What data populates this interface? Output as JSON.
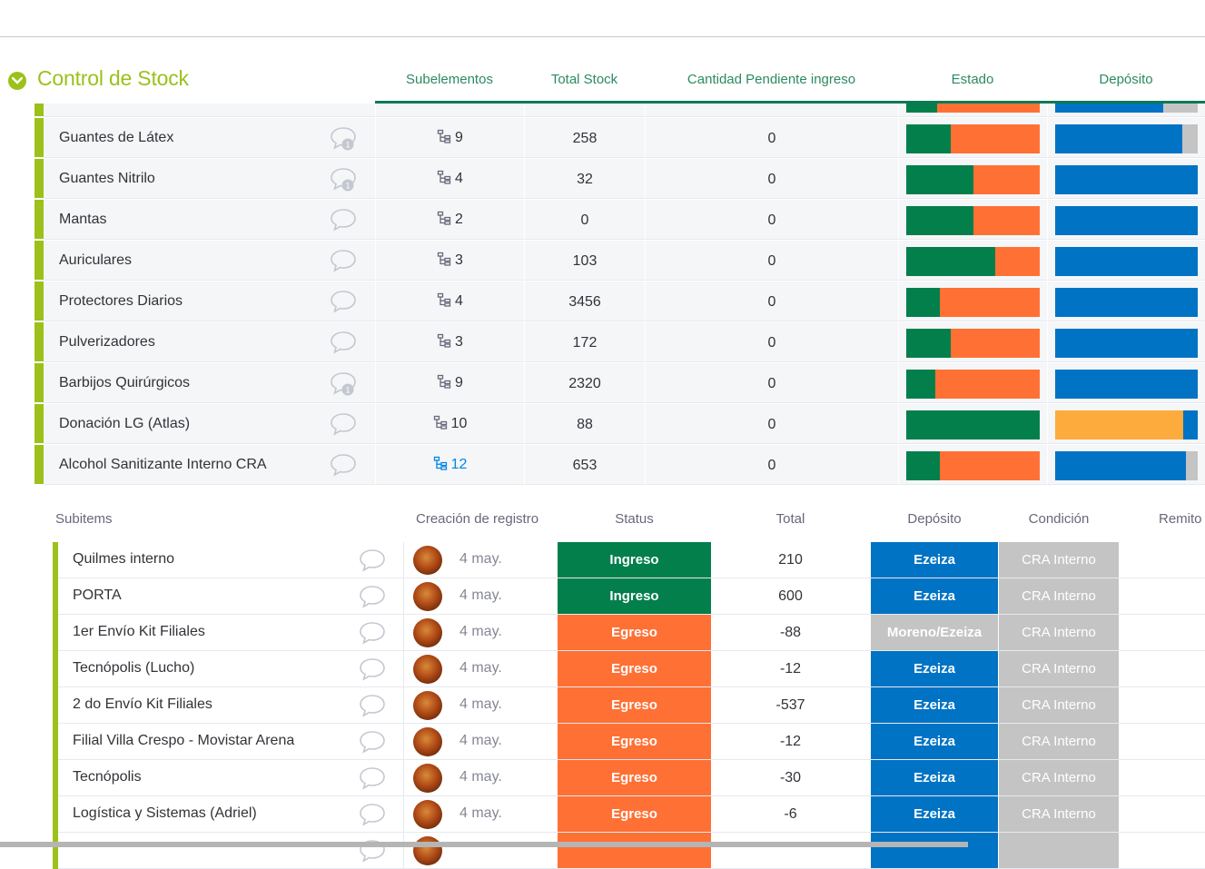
{
  "group": {
    "title": "Control de Stock",
    "color": "#9cc11a"
  },
  "columns": {
    "subelementos": "Subelementos",
    "total_stock": "Total Stock",
    "pendiente": "Cantidad Pendiente ingreso",
    "estado": "Estado",
    "deposito": "Depósito"
  },
  "items": [
    {
      "name": "",
      "sub": "",
      "stock": "",
      "pend": "",
      "estado": [
        0.23,
        0.77
      ],
      "deposito": [
        {
          "c": "#0073c4",
          "v": 0.76
        },
        {
          "c": "#c4c4c4",
          "v": 0.24
        }
      ],
      "partial": true
    },
    {
      "name": "Guantes de Látex",
      "sub": "9",
      "stock": "258",
      "pend": "0",
      "estado": [
        0.33,
        0.67
      ],
      "deposito": [
        {
          "c": "#0073c4",
          "v": 0.89
        },
        {
          "c": "#c4c4c4",
          "v": 0.11
        }
      ],
      "badge": "1"
    },
    {
      "name": "Guantes Nitrilo",
      "sub": "4",
      "stock": "32",
      "pend": "0",
      "estado": [
        0.5,
        0.5
      ],
      "deposito": [
        {
          "c": "#0073c4",
          "v": 1.0
        }
      ],
      "badge": "1"
    },
    {
      "name": "Mantas",
      "sub": "2",
      "stock": "0",
      "pend": "0",
      "estado": [
        0.5,
        0.5
      ],
      "deposito": [
        {
          "c": "#0073c4",
          "v": 1.0
        }
      ]
    },
    {
      "name": "Auriculares",
      "sub": "3",
      "stock": "103",
      "pend": "0",
      "estado": [
        0.67,
        0.33
      ],
      "deposito": [
        {
          "c": "#0073c4",
          "v": 1.0
        }
      ]
    },
    {
      "name": "Protectores Diarios",
      "sub": "4",
      "stock": "3456",
      "pend": "0",
      "estado": [
        0.25,
        0.75
      ],
      "deposito": [
        {
          "c": "#0073c4",
          "v": 1.0
        }
      ]
    },
    {
      "name": "Pulverizadores",
      "sub": "3",
      "stock": "172",
      "pend": "0",
      "estado": [
        0.33,
        0.67
      ],
      "deposito": [
        {
          "c": "#0073c4",
          "v": 1.0
        }
      ]
    },
    {
      "name": "Barbijos Quirúrgicos",
      "sub": "9",
      "stock": "2320",
      "pend": "0",
      "estado": [
        0.22,
        0.78
      ],
      "deposito": [
        {
          "c": "#0073c4",
          "v": 1.0
        }
      ],
      "badge": "1"
    },
    {
      "name": "Donación LG (Atlas)",
      "sub": "10",
      "stock": "88",
      "pend": "0",
      "estado": [
        1.0,
        0.0
      ],
      "deposito": [
        {
          "c": "#fdab3d",
          "v": 0.9
        },
        {
          "c": "#0073c4",
          "v": 0.1
        }
      ]
    },
    {
      "name": "Alcohol Sanitizante Interno CRA",
      "sub": "12",
      "stock": "653",
      "pend": "0",
      "estado": [
        0.25,
        0.75
      ],
      "deposito": [
        {
          "c": "#0073c4",
          "v": 0.92
        },
        {
          "c": "#c4c4c4",
          "v": 0.08
        }
      ],
      "active": true
    }
  ],
  "colors": {
    "done_green": "#037f4c",
    "working_orange": "#ff7035",
    "blue": "#0073c4",
    "grey": "#c4c4c4"
  },
  "subitems_header": {
    "subitems": "Subitems",
    "creacion": "Creación de registro",
    "status": "Status",
    "total": "Total",
    "deposito": "Depósito",
    "condicion": "Condición",
    "remito": "Remito"
  },
  "subitems": [
    {
      "name": "Quilmes interno",
      "date": "4 may.",
      "status": "Ingreso",
      "total": "210",
      "deposito": "Ezeiza",
      "condicion": "CRA Interno"
    },
    {
      "name": "PORTA",
      "date": "4 may.",
      "status": "Ingreso",
      "total": "600",
      "deposito": "Ezeiza",
      "condicion": "CRA Interno"
    },
    {
      "name": "1er Envío Kit Filiales",
      "date": "4 may.",
      "status": "Egreso",
      "total": "-88",
      "deposito": "Moreno/Ezeiza",
      "condicion": "CRA Interno"
    },
    {
      "name": "Tecnópolis (Lucho)",
      "date": "4 may.",
      "status": "Egreso",
      "total": "-12",
      "deposito": "Ezeiza",
      "condicion": "CRA Interno"
    },
    {
      "name": "2 do Envío Kit Filiales",
      "date": "4 may.",
      "status": "Egreso",
      "total": "-537",
      "deposito": "Ezeiza",
      "condicion": "CRA Interno"
    },
    {
      "name": "Filial Villa Crespo - Movistar Arena",
      "date": "4 may.",
      "status": "Egreso",
      "total": "-12",
      "deposito": "Ezeiza",
      "condicion": "CRA Interno"
    },
    {
      "name": "Tecnópolis",
      "date": "4 may.",
      "status": "Egreso",
      "total": "-30",
      "deposito": "Ezeiza",
      "condicion": "CRA Interno"
    },
    {
      "name": "Logística y Sistemas (Adriel)",
      "date": "4 may.",
      "status": "Egreso",
      "total": "-6",
      "deposito": "Ezeiza",
      "condicion": "CRA Interno"
    },
    {
      "name": "",
      "date": "",
      "status": "",
      "total": "",
      "deposito": "",
      "condicion": "",
      "partial": true
    }
  ]
}
